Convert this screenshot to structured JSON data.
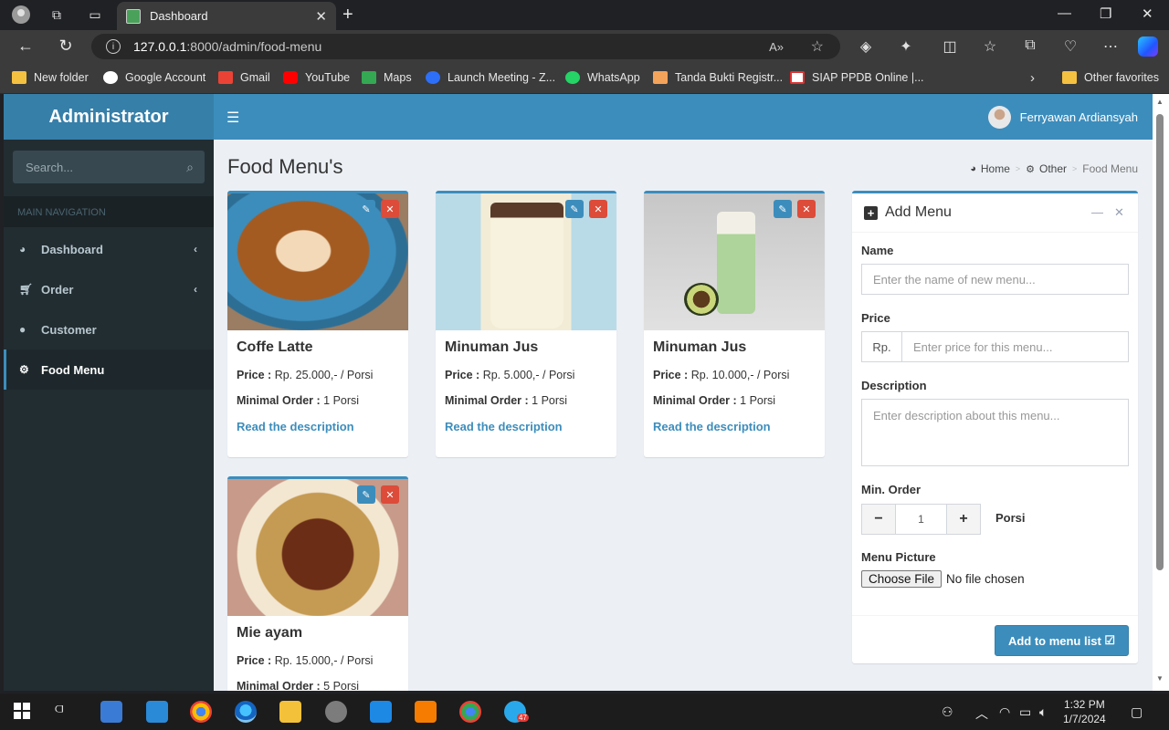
{
  "browser": {
    "tab_title": "Dashboard",
    "url_host": "127.0.0.1",
    "url_rest": ":8000/admin/food-menu",
    "bookmarks": [
      "New folder",
      "Google Account",
      "Gmail",
      "YouTube",
      "Maps",
      "Launch Meeting - Z...",
      "WhatsApp",
      "Tanda Bukti Registr...",
      "SIAP PPDB Online |..."
    ],
    "other_favorites": "Other favorites"
  },
  "app": {
    "logo": "Administrator",
    "user_name": "Ferryawan Ardiansyah"
  },
  "sidebar": {
    "search_placeholder": "Search...",
    "header": "MAIN NAVIGATION",
    "items": [
      {
        "label": "Dashboard",
        "icon": "dashboard-icon",
        "has_arrow": true
      },
      {
        "label": "Order",
        "icon": "cart-icon",
        "has_arrow": true
      },
      {
        "label": "Customer",
        "icon": "user-icon",
        "has_arrow": false
      },
      {
        "label": "Food Menu",
        "icon": "gear-icon",
        "has_arrow": false,
        "active": true
      }
    ]
  },
  "page": {
    "title": "Food Menu's",
    "breadcrumb": [
      "Home",
      "Other",
      "Food Menu"
    ]
  },
  "menu_labels": {
    "price": "Price :",
    "minimal_order": "Minimal Order :",
    "read_more": "Read the description"
  },
  "menus": [
    {
      "name": "Coffe Latte",
      "price": "Rp. 25.000,- / Porsi",
      "min_order": "1 Porsi"
    },
    {
      "name": "Minuman Jus",
      "price": "Rp. 5.000,- / Porsi",
      "min_order": "1 Porsi"
    },
    {
      "name": "Minuman Jus",
      "price": "Rp. 10.000,- / Porsi",
      "min_order": "1 Porsi"
    },
    {
      "name": "Mie ayam",
      "price": "Rp. 15.000,- / Porsi",
      "min_order": "5 Porsi"
    }
  ],
  "add_menu": {
    "title": "Add Menu",
    "name_label": "Name",
    "name_placeholder": "Enter the name of new menu...",
    "price_label": "Price",
    "price_addon": "Rp.",
    "price_placeholder": "Enter price for this menu...",
    "description_label": "Description",
    "description_placeholder": "Enter description about this menu...",
    "min_order_label": "Min. Order",
    "min_order_value": "1",
    "unit": "Porsi",
    "picture_label": "Menu Picture",
    "choose_file": "Choose File",
    "no_file": "No file chosen",
    "submit": "Add to menu list"
  },
  "taskbar": {
    "time": "1:32 PM",
    "date": "1/7/2024",
    "telegram_badge": "47"
  },
  "colors": {
    "primary": "#3c8dbc",
    "primary_dark": "#367fa9",
    "danger": "#dd4b39",
    "sidebar_bg": "#222d32"
  }
}
